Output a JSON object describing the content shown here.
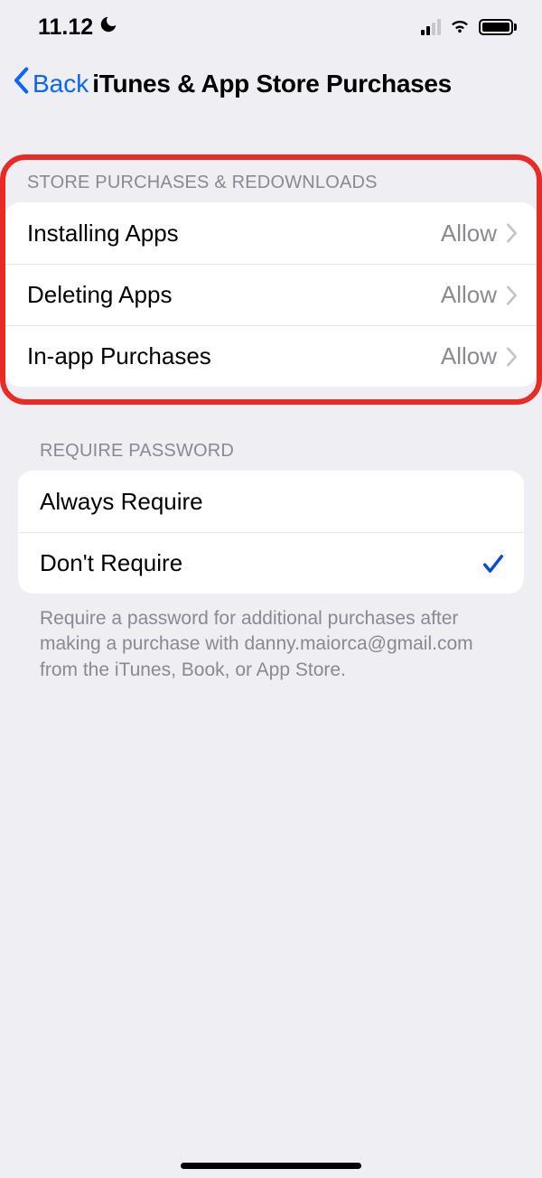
{
  "status": {
    "time": "11.12"
  },
  "nav": {
    "back_label": "Back",
    "title": "iTunes & App Store Purchases"
  },
  "section1": {
    "header": "STORE PURCHASES & REDOWNLOADS",
    "rows": [
      {
        "label": "Installing Apps",
        "value": "Allow"
      },
      {
        "label": "Deleting Apps",
        "value": "Allow"
      },
      {
        "label": "In-app Purchases",
        "value": "Allow"
      }
    ]
  },
  "section2": {
    "header": "REQUIRE PASSWORD",
    "rows": [
      {
        "label": "Always Require",
        "selected": false
      },
      {
        "label": "Don't Require",
        "selected": true
      }
    ],
    "footer": "Require a password for additional purchases after making a purchase with danny.maiorca@gmail.com from the iTunes, Book, or App Store."
  }
}
